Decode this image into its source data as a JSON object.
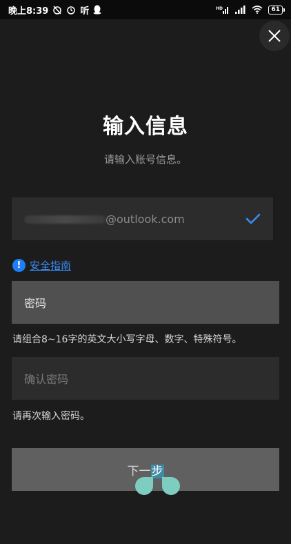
{
  "status_bar": {
    "time": "晚上8:39",
    "app_label": "听",
    "battery": "61"
  },
  "title": "输入信息",
  "subtitle": "请输入账号信息。",
  "email": {
    "value": "      @outlook.com",
    "visible_suffix": "@outlook.com"
  },
  "guide_link": "安全指南",
  "password": {
    "placeholder": "密码"
  },
  "password_hint": "请组合8~16字的英文大小写字母、数字、特殊符号。",
  "confirm_password": {
    "placeholder": "确认密码"
  },
  "confirm_hint": "请再次输入密码。",
  "next_button": {
    "prefix": "下一",
    "highlighted": "步"
  },
  "colors": {
    "background": "#1c1c1c",
    "accent": "#1f7ef5",
    "check": "#3b8df7",
    "selection_handle": "#7ecdc1"
  }
}
